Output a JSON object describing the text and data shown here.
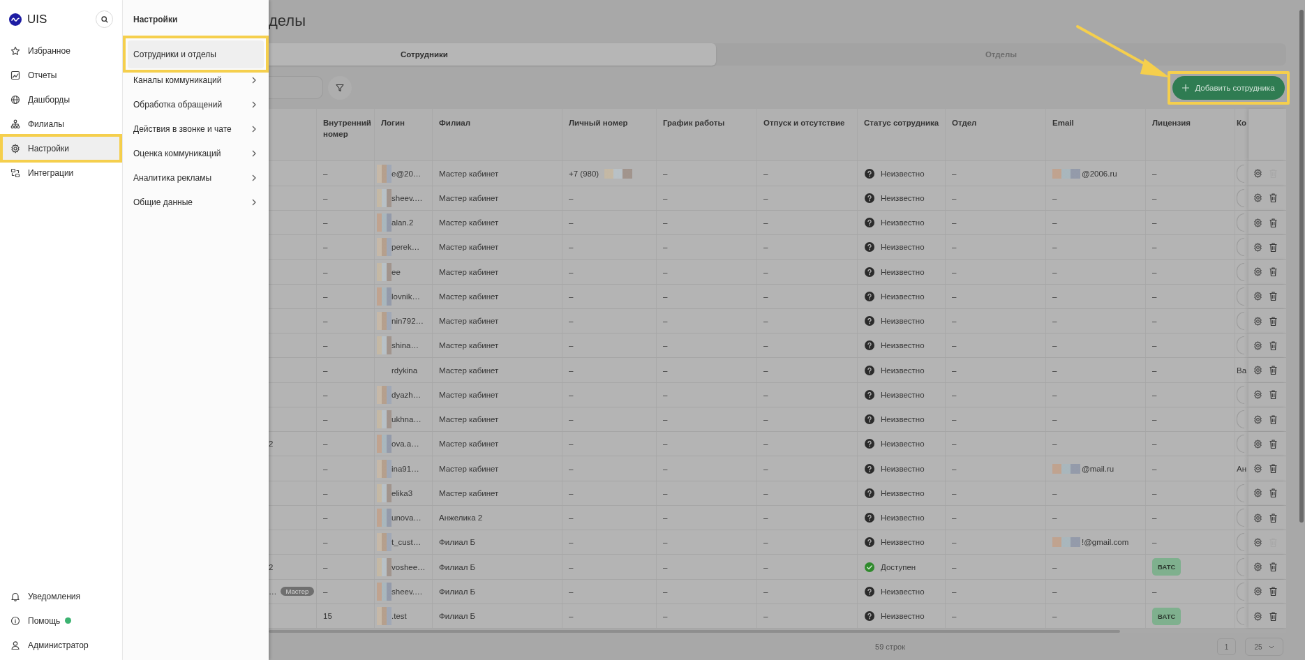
{
  "sidebar": {
    "logo": "UIS",
    "items": [
      {
        "label": "Избранное",
        "selected": false,
        "highlighted": false
      },
      {
        "label": "Отчеты",
        "selected": false,
        "highlighted": false
      },
      {
        "label": "Дашборды",
        "selected": false,
        "highlighted": false
      },
      {
        "label": "Филиалы",
        "selected": false,
        "highlighted": false
      },
      {
        "label": "Настройки",
        "selected": true,
        "highlighted": true
      },
      {
        "label": "Интеграции",
        "selected": false,
        "highlighted": false
      }
    ],
    "bottom_items": [
      {
        "label": "Уведомления",
        "status_dot": false
      },
      {
        "label": "Помощь",
        "status_dot": true
      },
      {
        "label": "Администратор",
        "status_dot": false
      }
    ]
  },
  "submenu": {
    "title": "Настройки",
    "items": [
      {
        "label": "Сотрудники и отделы",
        "selected": true,
        "highlighted": true,
        "has_children": false
      },
      {
        "label": "Каналы коммуникаций",
        "selected": false,
        "highlighted": false,
        "has_children": true
      },
      {
        "label": "Обработка обращений",
        "selected": false,
        "highlighted": false,
        "has_children": true
      },
      {
        "label": "Действия в звонке и чате",
        "selected": false,
        "highlighted": false,
        "has_children": true
      },
      {
        "label": "Оценка коммуникаций",
        "selected": false,
        "highlighted": false,
        "has_children": true
      },
      {
        "label": "Аналитика рекламы",
        "selected": false,
        "highlighted": false,
        "has_children": true
      },
      {
        "label": "Общие данные",
        "selected": false,
        "highlighted": false,
        "has_children": true
      }
    ]
  },
  "page": {
    "title": "делы"
  },
  "tabs": [
    {
      "label": "Сотрудники",
      "selected": true
    },
    {
      "label": "Отделы",
      "selected": false
    }
  ],
  "add_button": {
    "label": "Добавить сотрудника",
    "highlighted": true,
    "arrow": true
  },
  "table": {
    "columns": [
      "Внутренний номер",
      "Логин",
      "Филиал",
      "Личный номер",
      "График работы",
      "Отпуск и отсутствие",
      "Статус сотрудника",
      "Отдел",
      "Email",
      "Лицензия",
      "Ко"
    ],
    "rows": [
      {
        "internal_number": "–",
        "login": "e@20…",
        "login_blurred": true,
        "branch": "Мастер кабинет",
        "personal_number": "+7 (980)",
        "number_blurred": true,
        "schedule": "–",
        "absence": "–",
        "status": {
          "kind": "unknown",
          "label": "Неизвестно"
        },
        "department": "–",
        "email": "@2006.ru",
        "email_blurred": true,
        "license": {
          "kind": "text",
          "text": "–"
        },
        "column_12": {
          "kind": "control"
        },
        "delete_disabled": true
      },
      {
        "internal_number": "–",
        "login": "sheev.…",
        "login_blurred": true,
        "branch": "Мастер кабинет",
        "personal_number": "–",
        "number_blurred": false,
        "schedule": "–",
        "absence": "–",
        "status": {
          "kind": "unknown",
          "label": "Неизвестно"
        },
        "department": "–",
        "email": "–",
        "email_blurred": false,
        "license": {
          "kind": "text",
          "text": "–"
        },
        "column_12": {
          "kind": "control"
        },
        "delete_disabled": false
      },
      {
        "internal_number": "–",
        "login": "alan.2",
        "login_blurred": true,
        "branch": "Мастер кабинет",
        "personal_number": "–",
        "number_blurred": false,
        "schedule": "–",
        "absence": "–",
        "status": {
          "kind": "unknown",
          "label": "Неизвестно"
        },
        "department": "–",
        "email": "–",
        "email_blurred": false,
        "license": {
          "kind": "text",
          "text": "–"
        },
        "column_12": {
          "kind": "control"
        },
        "delete_disabled": false
      },
      {
        "internal_number": "–",
        "login": "perek…",
        "login_blurred": true,
        "branch": "Мастер кабинет",
        "personal_number": "–",
        "number_blurred": false,
        "schedule": "–",
        "absence": "–",
        "status": {
          "kind": "unknown",
          "label": "Неизвестно"
        },
        "department": "–",
        "email": "–",
        "email_blurred": false,
        "license": {
          "kind": "text",
          "text": "–"
        },
        "column_12": {
          "kind": "control"
        },
        "delete_disabled": false
      },
      {
        "internal_number": "–",
        "login": "ee",
        "login_blurred": true,
        "branch": "Мастер кабинет",
        "personal_number": "–",
        "number_blurred": false,
        "schedule": "–",
        "absence": "–",
        "status": {
          "kind": "unknown",
          "label": "Неизвестно"
        },
        "department": "–",
        "email": "–",
        "email_blurred": false,
        "license": {
          "kind": "text",
          "text": "–"
        },
        "column_12": {
          "kind": "control"
        },
        "delete_disabled": false
      },
      {
        "internal_number": "–",
        "login": "lovnik…",
        "login_blurred": true,
        "branch": "Мастер кабинет",
        "personal_number": "–",
        "number_blurred": false,
        "schedule": "–",
        "absence": "–",
        "status": {
          "kind": "unknown",
          "label": "Неизвестно"
        },
        "department": "–",
        "email": "–",
        "email_blurred": false,
        "license": {
          "kind": "text",
          "text": "–"
        },
        "column_12": {
          "kind": "control"
        },
        "delete_disabled": false
      },
      {
        "internal_number": "–",
        "login": "nin792…",
        "login_blurred": true,
        "branch": "Мастер кабинет",
        "personal_number": "–",
        "number_blurred": false,
        "schedule": "–",
        "absence": "–",
        "status": {
          "kind": "unknown",
          "label": "Неизвестно"
        },
        "department": "–",
        "email": "–",
        "email_blurred": false,
        "license": {
          "kind": "text",
          "text": "–"
        },
        "column_12": {
          "kind": "control"
        },
        "delete_disabled": false
      },
      {
        "internal_number": "–",
        "login": "shina…",
        "login_blurred": true,
        "branch": "Мастер кабинет",
        "personal_number": "–",
        "number_blurred": false,
        "schedule": "–",
        "absence": "–",
        "status": {
          "kind": "unknown",
          "label": "Неизвестно"
        },
        "department": "–",
        "email": "–",
        "email_blurred": false,
        "license": {
          "kind": "text",
          "text": "–"
        },
        "column_12": {
          "kind": "control"
        },
        "delete_disabled": false
      },
      {
        "internal_number": "–",
        "login": "rdykina",
        "login_blurred": false,
        "branch": "Мастер кабинет",
        "personal_number": "–",
        "number_blurred": false,
        "schedule": "–",
        "absence": "–",
        "status": {
          "kind": "unknown",
          "label": "Неизвестно"
        },
        "department": "–",
        "email": "–",
        "email_blurred": false,
        "license": {
          "kind": "text",
          "text": "–"
        },
        "column_12": {
          "kind": "text",
          "text": "Ва"
        },
        "delete_disabled": false
      },
      {
        "internal_number": "–",
        "login": "dyazh…",
        "login_blurred": true,
        "branch": "Мастер кабинет",
        "personal_number": "–",
        "number_blurred": false,
        "schedule": "–",
        "absence": "–",
        "status": {
          "kind": "unknown",
          "label": "Неизвестно"
        },
        "department": "–",
        "email": "–",
        "email_blurred": false,
        "license": {
          "kind": "text",
          "text": "–"
        },
        "column_12": {
          "kind": "control"
        },
        "delete_disabled": false
      },
      {
        "internal_number": "–",
        "login": "ukhna…",
        "login_blurred": true,
        "branch": "Мастер кабинет",
        "personal_number": "–",
        "number_blurred": false,
        "schedule": "–",
        "absence": "–",
        "status": {
          "kind": "unknown",
          "label": "Неизвестно"
        },
        "department": "–",
        "email": "–",
        "email_blurred": false,
        "license": {
          "kind": "text",
          "text": "–"
        },
        "column_12": {
          "kind": "control"
        },
        "delete_disabled": false
      },
      {
        "column_1": "2",
        "internal_number": "–",
        "login": "ova.a…",
        "login_blurred": true,
        "branch": "Мастер кабинет",
        "personal_number": "–",
        "number_blurred": false,
        "schedule": "–",
        "absence": "–",
        "status": {
          "kind": "unknown",
          "label": "Неизвестно"
        },
        "department": "–",
        "email": "–",
        "email_blurred": false,
        "license": {
          "kind": "text",
          "text": "–"
        },
        "column_12": {
          "kind": "control"
        },
        "delete_disabled": false
      },
      {
        "internal_number": "–",
        "login": "ina91…",
        "login_blurred": true,
        "branch": "Мастер кабинет",
        "personal_number": "–",
        "number_blurred": false,
        "schedule": "–",
        "absence": "–",
        "status": {
          "kind": "unknown",
          "label": "Неизвестно"
        },
        "department": "–",
        "email": "@mail.ru",
        "email_blurred": true,
        "license": {
          "kind": "text",
          "text": "–"
        },
        "column_12": {
          "kind": "text",
          "text": "Ан"
        },
        "delete_disabled": false
      },
      {
        "internal_number": "–",
        "login": "elika3",
        "login_blurred": true,
        "branch": "Мастер кабинет",
        "personal_number": "–",
        "number_blurred": false,
        "schedule": "–",
        "absence": "–",
        "status": {
          "kind": "unknown",
          "label": "Неизвестно"
        },
        "department": "–",
        "email": "–",
        "email_blurred": false,
        "license": {
          "kind": "text",
          "text": "–"
        },
        "column_12": {
          "kind": "control"
        },
        "delete_disabled": false
      },
      {
        "internal_number": "–",
        "login": "unova…",
        "login_blurred": true,
        "branch": "Анжелика 2",
        "personal_number": "–",
        "number_blurred": false,
        "schedule": "–",
        "absence": "–",
        "status": {
          "kind": "unknown",
          "label": "Неизвестно"
        },
        "department": "–",
        "email": "–",
        "email_blurred": false,
        "license": {
          "kind": "text",
          "text": "–"
        },
        "column_12": {
          "kind": "control"
        },
        "delete_disabled": false
      },
      {
        "internal_number": "–",
        "login": "t_cust…",
        "login_blurred": true,
        "branch": "Филиал Б",
        "personal_number": "–",
        "number_blurred": false,
        "schedule": "–",
        "absence": "–",
        "status": {
          "kind": "unknown",
          "label": "Неизвестно"
        },
        "department": "–",
        "email": "!@gmail.com",
        "email_blurred": true,
        "license": {
          "kind": "text",
          "text": "–"
        },
        "column_12": {
          "kind": "control"
        },
        "delete_disabled": true
      },
      {
        "column_1": "2",
        "internal_number": "–",
        "login": "voshee…",
        "login_blurred": true,
        "branch": "Филиал Б",
        "personal_number": "–",
        "number_blurred": false,
        "schedule": "–",
        "absence": "–",
        "status": {
          "kind": "available",
          "label": "Доступен"
        },
        "department": "–",
        "email": "–",
        "email_blurred": false,
        "license": {
          "kind": "badge",
          "text": "ВАТС"
        },
        "column_12": {
          "kind": "control"
        },
        "delete_disabled": false
      },
      {
        "column_1": "…",
        "column_1_badge": "Мастер",
        "internal_number": "–",
        "login": "sheev.…",
        "login_blurred": true,
        "branch": "Филиал Б",
        "personal_number": "–",
        "number_blurred": false,
        "schedule": "–",
        "absence": "–",
        "status": {
          "kind": "unknown",
          "label": "Неизвестно"
        },
        "department": "–",
        "email": "–",
        "email_blurred": false,
        "license": {
          "kind": "text",
          "text": "–"
        },
        "column_12": {
          "kind": "control"
        },
        "delete_disabled": false
      },
      {
        "internal_number": "15",
        "login": ".test",
        "login_blurred": true,
        "branch": "Филиал Б",
        "personal_number": "–",
        "number_blurred": false,
        "schedule": "–",
        "absence": "–",
        "status": {
          "kind": "unknown",
          "label": "Неизвестно"
        },
        "department": "–",
        "email": "–",
        "email_blurred": false,
        "license": {
          "kind": "badge",
          "text": "ВАТС"
        },
        "column_12": {
          "kind": "control"
        },
        "delete_disabled": false
      }
    ]
  },
  "footer": {
    "row_count": "59 строк",
    "page": "1",
    "page_size": "25"
  }
}
